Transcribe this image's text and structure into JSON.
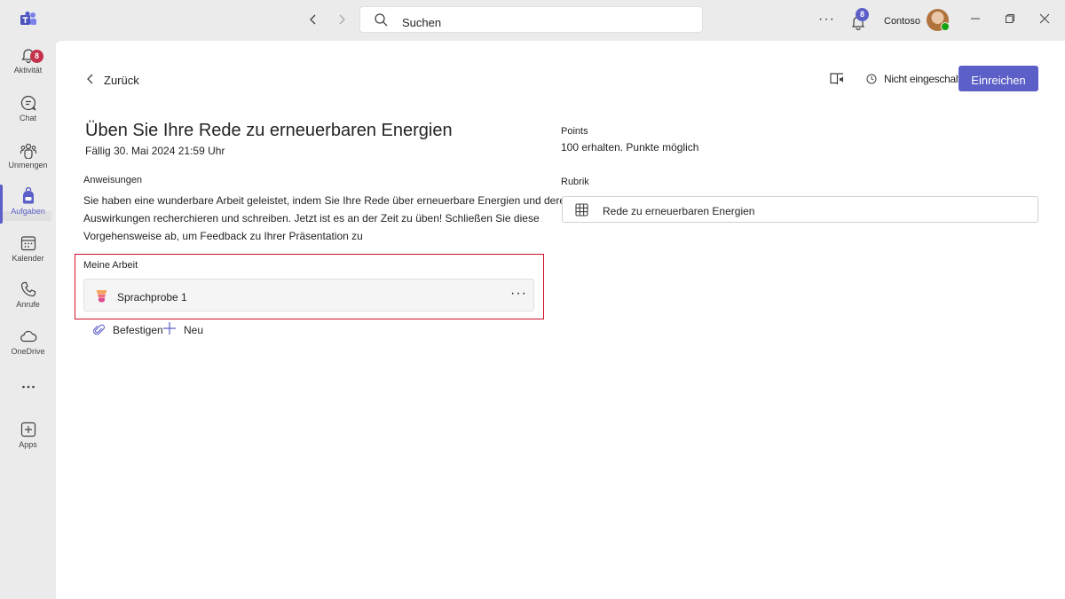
{
  "titlebar": {
    "search_placeholder": "Suchen",
    "org_name": "Contoso",
    "notification_count": "8"
  },
  "rail": {
    "items": [
      {
        "label": "Aktivität",
        "icon": "bell-icon",
        "badge": "8"
      },
      {
        "label": "Chat",
        "icon": "chat-icon"
      },
      {
        "label": "Unmengen",
        "icon": "teams-icon"
      },
      {
        "label": "Aufgaben",
        "icon": "backpack-icon",
        "active": true
      },
      {
        "label": "Kalender",
        "icon": "calendar-icon"
      },
      {
        "label": "Anrufe",
        "icon": "phone-icon"
      },
      {
        "label": "OneDrive",
        "icon": "cloud-icon"
      },
      {
        "label": "",
        "icon": "more-icon"
      },
      {
        "label": "Apps",
        "icon": "add-apps-icon"
      }
    ]
  },
  "header": {
    "back_label": "Zurück",
    "status": "Nicht eingeschalten",
    "submit_label": "Einreichen"
  },
  "assignment": {
    "title": "Üben Sie Ihre Rede zu erneuerbaren Energien",
    "due": "Fällig 30. Mai 2024 21:59 Uhr",
    "instructions_heading": "Anweisungen",
    "instructions": "Sie haben eine wunderbare Arbeit geleistet, indem Sie Ihre Rede über erneuerbare Energien und deren Auswirkungen recherchieren und schreiben. Jetzt ist es an der Zeit zu üben! Schließen Sie diese Vorgehensweise ab, um Feedback zu Ihrer Präsentation zu",
    "my_work_heading": "Meine Arbeit",
    "work_items": [
      {
        "label": "Sprachprobe 1"
      }
    ],
    "attach_label": "Befestigen",
    "new_label": "Neu"
  },
  "side": {
    "points_heading": "Points",
    "points_value": "100",
    "points_text": "erhalten. Punkte möglich",
    "rubric_heading": "Rubrik",
    "rubric_label": "Rede zu erneuerbaren Energien"
  },
  "colors": {
    "accent": "#5b5fc7",
    "highlight_border": "#d0102a",
    "badge_red": "#c4314b"
  }
}
